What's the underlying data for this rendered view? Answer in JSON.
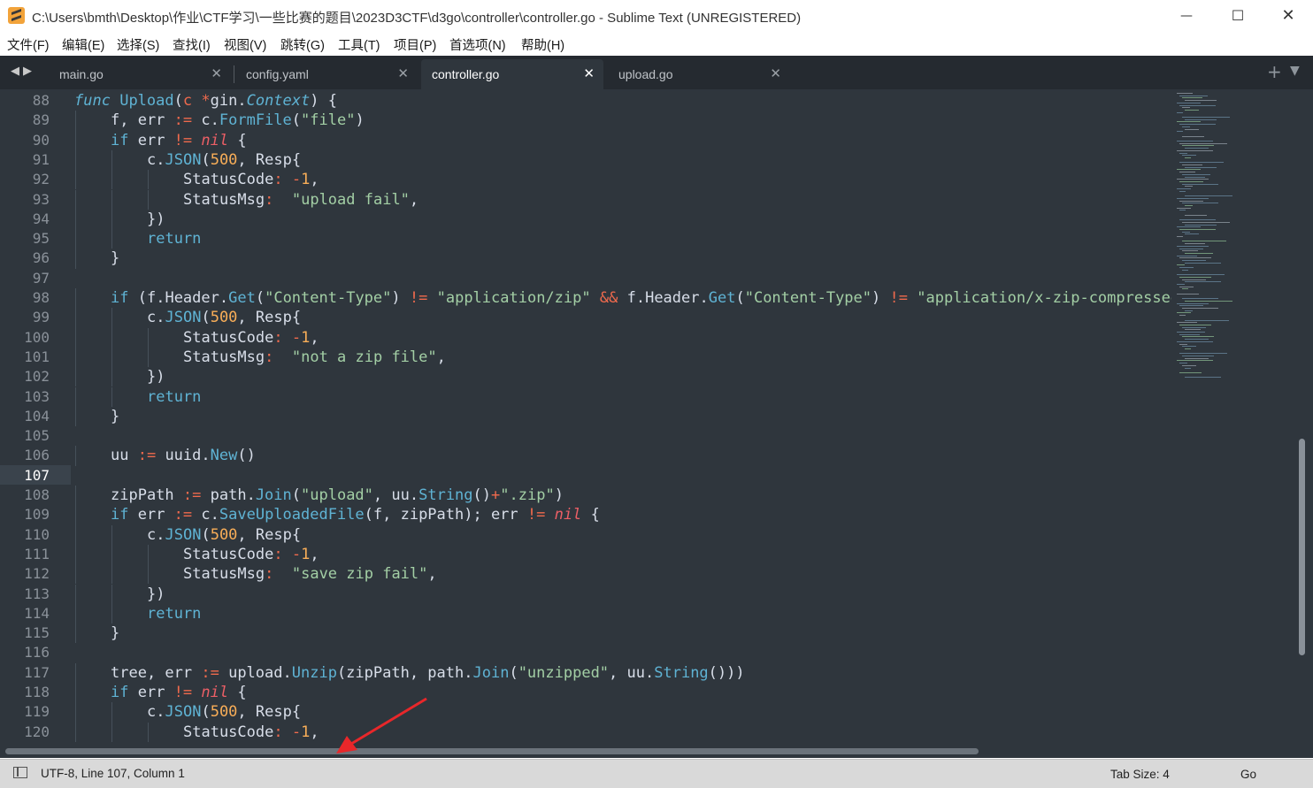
{
  "window": {
    "title": "C:\\Users\\bmth\\Desktop\\作业\\CTF学习\\一些比赛的题目\\2023D3CTF\\d3go\\controller\\controller.go - Sublime Text (UNREGISTERED)",
    "minimize_glyph": "—",
    "maximize_glyph": "☐",
    "close_glyph": "✕"
  },
  "menu": [
    "文件(F)",
    "编辑(E)",
    "选择(S)",
    "查找(I)",
    "视图(V)",
    "跳转(G)",
    "工具(T)",
    "项目(P)",
    "首选项(N)",
    "帮助(H)"
  ],
  "tabs": [
    {
      "label": "main.go",
      "active": false
    },
    {
      "label": "config.yaml",
      "active": false
    },
    {
      "label": "controller.go",
      "active": true
    },
    {
      "label": "upload.go",
      "active": false
    }
  ],
  "tab_close_glyph": "✕",
  "new_tab_glyph": "+",
  "nav_arrows": "◀▶",
  "editor": {
    "current_line": 107,
    "lines": [
      {
        "n": 88,
        "indent": 0,
        "t": [
          [
            "kwi",
            "func"
          ],
          [
            "pl",
            " "
          ],
          [
            "fn",
            "Upload"
          ],
          [
            "pl",
            "("
          ],
          [
            "op",
            "c"
          ],
          [
            "pl",
            " "
          ],
          [
            "op",
            "*"
          ],
          [
            "pl",
            "gin"
          ],
          [
            "dot",
            "."
          ],
          [
            "ty",
            "Context"
          ],
          [
            "pl",
            ") {"
          ]
        ]
      },
      {
        "n": 89,
        "indent": 1,
        "t": [
          [
            "pl",
            "f, err "
          ],
          [
            "op",
            ":="
          ],
          [
            "pl",
            " c"
          ],
          [
            "dot",
            "."
          ],
          [
            "fn",
            "FormFile"
          ],
          [
            "pl",
            "("
          ],
          [
            "st",
            "\"file\""
          ],
          [
            "pl",
            ")"
          ]
        ]
      },
      {
        "n": 90,
        "indent": 1,
        "t": [
          [
            "kw",
            "if"
          ],
          [
            "pl",
            " err "
          ],
          [
            "op",
            "!="
          ],
          [
            "pl",
            " "
          ],
          [
            "ni",
            "nil"
          ],
          [
            "pl",
            " {"
          ]
        ]
      },
      {
        "n": 91,
        "indent": 2,
        "t": [
          [
            "pl",
            "c"
          ],
          [
            "dot",
            "."
          ],
          [
            "fn",
            "JSON"
          ],
          [
            "pl",
            "("
          ],
          [
            "nu",
            "500"
          ],
          [
            "pl",
            ", Resp{"
          ]
        ]
      },
      {
        "n": 92,
        "indent": 3,
        "t": [
          [
            "pl",
            "StatusCode"
          ],
          [
            "op",
            ":"
          ],
          [
            "pl",
            " "
          ],
          [
            "op",
            "-"
          ],
          [
            "nu",
            "1"
          ],
          [
            "pl",
            ","
          ]
        ]
      },
      {
        "n": 93,
        "indent": 3,
        "t": [
          [
            "pl",
            "StatusMsg"
          ],
          [
            "op",
            ":"
          ],
          [
            "pl",
            "  "
          ],
          [
            "st",
            "\"upload fail\""
          ],
          [
            "pl",
            ","
          ]
        ]
      },
      {
        "n": 94,
        "indent": 2,
        "t": [
          [
            "pl",
            "})"
          ]
        ]
      },
      {
        "n": 95,
        "indent": 2,
        "t": [
          [
            "kw",
            "return"
          ]
        ]
      },
      {
        "n": 96,
        "indent": 1,
        "t": [
          [
            "pl",
            "}"
          ]
        ]
      },
      {
        "n": 97,
        "indent": 0,
        "t": []
      },
      {
        "n": 98,
        "indent": 1,
        "t": [
          [
            "kw",
            "if"
          ],
          [
            "pl",
            " (f"
          ],
          [
            "dot",
            "."
          ],
          [
            "pl",
            "Header"
          ],
          [
            "dot",
            "."
          ],
          [
            "fn",
            "Get"
          ],
          [
            "pl",
            "("
          ],
          [
            "st",
            "\"Content-Type\""
          ],
          [
            "pl",
            ") "
          ],
          [
            "op",
            "!="
          ],
          [
            "pl",
            " "
          ],
          [
            "st",
            "\"application/zip\""
          ],
          [
            "pl",
            " "
          ],
          [
            "op",
            "&&"
          ],
          [
            "pl",
            " f"
          ],
          [
            "dot",
            "."
          ],
          [
            "pl",
            "Header"
          ],
          [
            "dot",
            "."
          ],
          [
            "fn",
            "Get"
          ],
          [
            "pl",
            "("
          ],
          [
            "st",
            "\"Content-Type\""
          ],
          [
            "pl",
            ") "
          ],
          [
            "op",
            "!="
          ],
          [
            "pl",
            " "
          ],
          [
            "st",
            "\"application/x-zip-compressed\""
          ],
          [
            "pl",
            ") {"
          ]
        ]
      },
      {
        "n": 99,
        "indent": 2,
        "t": [
          [
            "pl",
            "c"
          ],
          [
            "dot",
            "."
          ],
          [
            "fn",
            "JSON"
          ],
          [
            "pl",
            "("
          ],
          [
            "nu",
            "500"
          ],
          [
            "pl",
            ", Resp{"
          ]
        ]
      },
      {
        "n": 100,
        "indent": 3,
        "t": [
          [
            "pl",
            "StatusCode"
          ],
          [
            "op",
            ":"
          ],
          [
            "pl",
            " "
          ],
          [
            "op",
            "-"
          ],
          [
            "nu",
            "1"
          ],
          [
            "pl",
            ","
          ]
        ]
      },
      {
        "n": 101,
        "indent": 3,
        "t": [
          [
            "pl",
            "StatusMsg"
          ],
          [
            "op",
            ":"
          ],
          [
            "pl",
            "  "
          ],
          [
            "st",
            "\"not a zip file\""
          ],
          [
            "pl",
            ","
          ]
        ]
      },
      {
        "n": 102,
        "indent": 2,
        "t": [
          [
            "pl",
            "})"
          ]
        ]
      },
      {
        "n": 103,
        "indent": 2,
        "t": [
          [
            "kw",
            "return"
          ]
        ]
      },
      {
        "n": 104,
        "indent": 1,
        "t": [
          [
            "pl",
            "}"
          ]
        ]
      },
      {
        "n": 105,
        "indent": 0,
        "t": []
      },
      {
        "n": 106,
        "indent": 1,
        "t": [
          [
            "pl",
            "uu "
          ],
          [
            "op",
            ":="
          ],
          [
            "pl",
            " uuid"
          ],
          [
            "dot",
            "."
          ],
          [
            "fn",
            "New"
          ],
          [
            "pl",
            "()"
          ]
        ]
      },
      {
        "n": 107,
        "indent": 0,
        "t": []
      },
      {
        "n": 108,
        "indent": 1,
        "t": [
          [
            "pl",
            "zipPath "
          ],
          [
            "op",
            ":="
          ],
          [
            "pl",
            " path"
          ],
          [
            "dot",
            "."
          ],
          [
            "fn",
            "Join"
          ],
          [
            "pl",
            "("
          ],
          [
            "st",
            "\"upload\""
          ],
          [
            "pl",
            ", uu"
          ],
          [
            "dot",
            "."
          ],
          [
            "fn",
            "String"
          ],
          [
            "pl",
            "()"
          ],
          [
            "op",
            "+"
          ],
          [
            "st",
            "\".zip\""
          ],
          [
            "pl",
            ")"
          ]
        ]
      },
      {
        "n": 109,
        "indent": 1,
        "t": [
          [
            "kw",
            "if"
          ],
          [
            "pl",
            " err "
          ],
          [
            "op",
            ":="
          ],
          [
            "pl",
            " c"
          ],
          [
            "dot",
            "."
          ],
          [
            "fn",
            "SaveUploadedFile"
          ],
          [
            "pl",
            "(f, zipPath); err "
          ],
          [
            "op",
            "!="
          ],
          [
            "pl",
            " "
          ],
          [
            "ni",
            "nil"
          ],
          [
            "pl",
            " {"
          ]
        ]
      },
      {
        "n": 110,
        "indent": 2,
        "t": [
          [
            "pl",
            "c"
          ],
          [
            "dot",
            "."
          ],
          [
            "fn",
            "JSON"
          ],
          [
            "pl",
            "("
          ],
          [
            "nu",
            "500"
          ],
          [
            "pl",
            ", Resp{"
          ]
        ]
      },
      {
        "n": 111,
        "indent": 3,
        "t": [
          [
            "pl",
            "StatusCode"
          ],
          [
            "op",
            ":"
          ],
          [
            "pl",
            " "
          ],
          [
            "op",
            "-"
          ],
          [
            "nu",
            "1"
          ],
          [
            "pl",
            ","
          ]
        ]
      },
      {
        "n": 112,
        "indent": 3,
        "t": [
          [
            "pl",
            "StatusMsg"
          ],
          [
            "op",
            ":"
          ],
          [
            "pl",
            "  "
          ],
          [
            "st",
            "\"save zip fail\""
          ],
          [
            "pl",
            ","
          ]
        ]
      },
      {
        "n": 113,
        "indent": 2,
        "t": [
          [
            "pl",
            "})"
          ]
        ]
      },
      {
        "n": 114,
        "indent": 2,
        "t": [
          [
            "kw",
            "return"
          ]
        ]
      },
      {
        "n": 115,
        "indent": 1,
        "t": [
          [
            "pl",
            "}"
          ]
        ]
      },
      {
        "n": 116,
        "indent": 0,
        "t": []
      },
      {
        "n": 117,
        "indent": 1,
        "t": [
          [
            "pl",
            "tree, err "
          ],
          [
            "op",
            ":="
          ],
          [
            "pl",
            " upload"
          ],
          [
            "dot",
            "."
          ],
          [
            "fn",
            "Unzip"
          ],
          [
            "pl",
            "(zipPath, path"
          ],
          [
            "dot",
            "."
          ],
          [
            "fn",
            "Join"
          ],
          [
            "pl",
            "("
          ],
          [
            "st",
            "\"unzipped\""
          ],
          [
            "pl",
            ", uu"
          ],
          [
            "dot",
            "."
          ],
          [
            "fn",
            "String"
          ],
          [
            "pl",
            "()))"
          ]
        ]
      },
      {
        "n": 118,
        "indent": 1,
        "t": [
          [
            "kw",
            "if"
          ],
          [
            "pl",
            " err "
          ],
          [
            "op",
            "!="
          ],
          [
            "pl",
            " "
          ],
          [
            "ni",
            "nil"
          ],
          [
            "pl",
            " {"
          ]
        ]
      },
      {
        "n": 119,
        "indent": 2,
        "t": [
          [
            "pl",
            "c"
          ],
          [
            "dot",
            "."
          ],
          [
            "fn",
            "JSON"
          ],
          [
            "pl",
            "("
          ],
          [
            "nu",
            "500"
          ],
          [
            "pl",
            ", Resp{"
          ]
        ]
      },
      {
        "n": 120,
        "indent": 3,
        "t": [
          [
            "pl",
            "StatusCode"
          ],
          [
            "op",
            ":"
          ],
          [
            "pl",
            " "
          ],
          [
            "op",
            "-"
          ],
          [
            "nu",
            "1"
          ],
          [
            "pl",
            ","
          ]
        ]
      }
    ]
  },
  "status": {
    "encoding_position": "UTF-8, Line 107, Column 1",
    "tab_size": "Tab Size: 4",
    "syntax": "Go"
  },
  "colors": {
    "editor_bg": "#2f363d",
    "tabbar_bg": "#252a30",
    "keyword": "#5fb3d4",
    "operator": "#f06a4d",
    "string": "#a3cfa5",
    "number": "#f9ae58",
    "nil": "#ec5f66",
    "annotation_arrow": "#e8272a"
  }
}
